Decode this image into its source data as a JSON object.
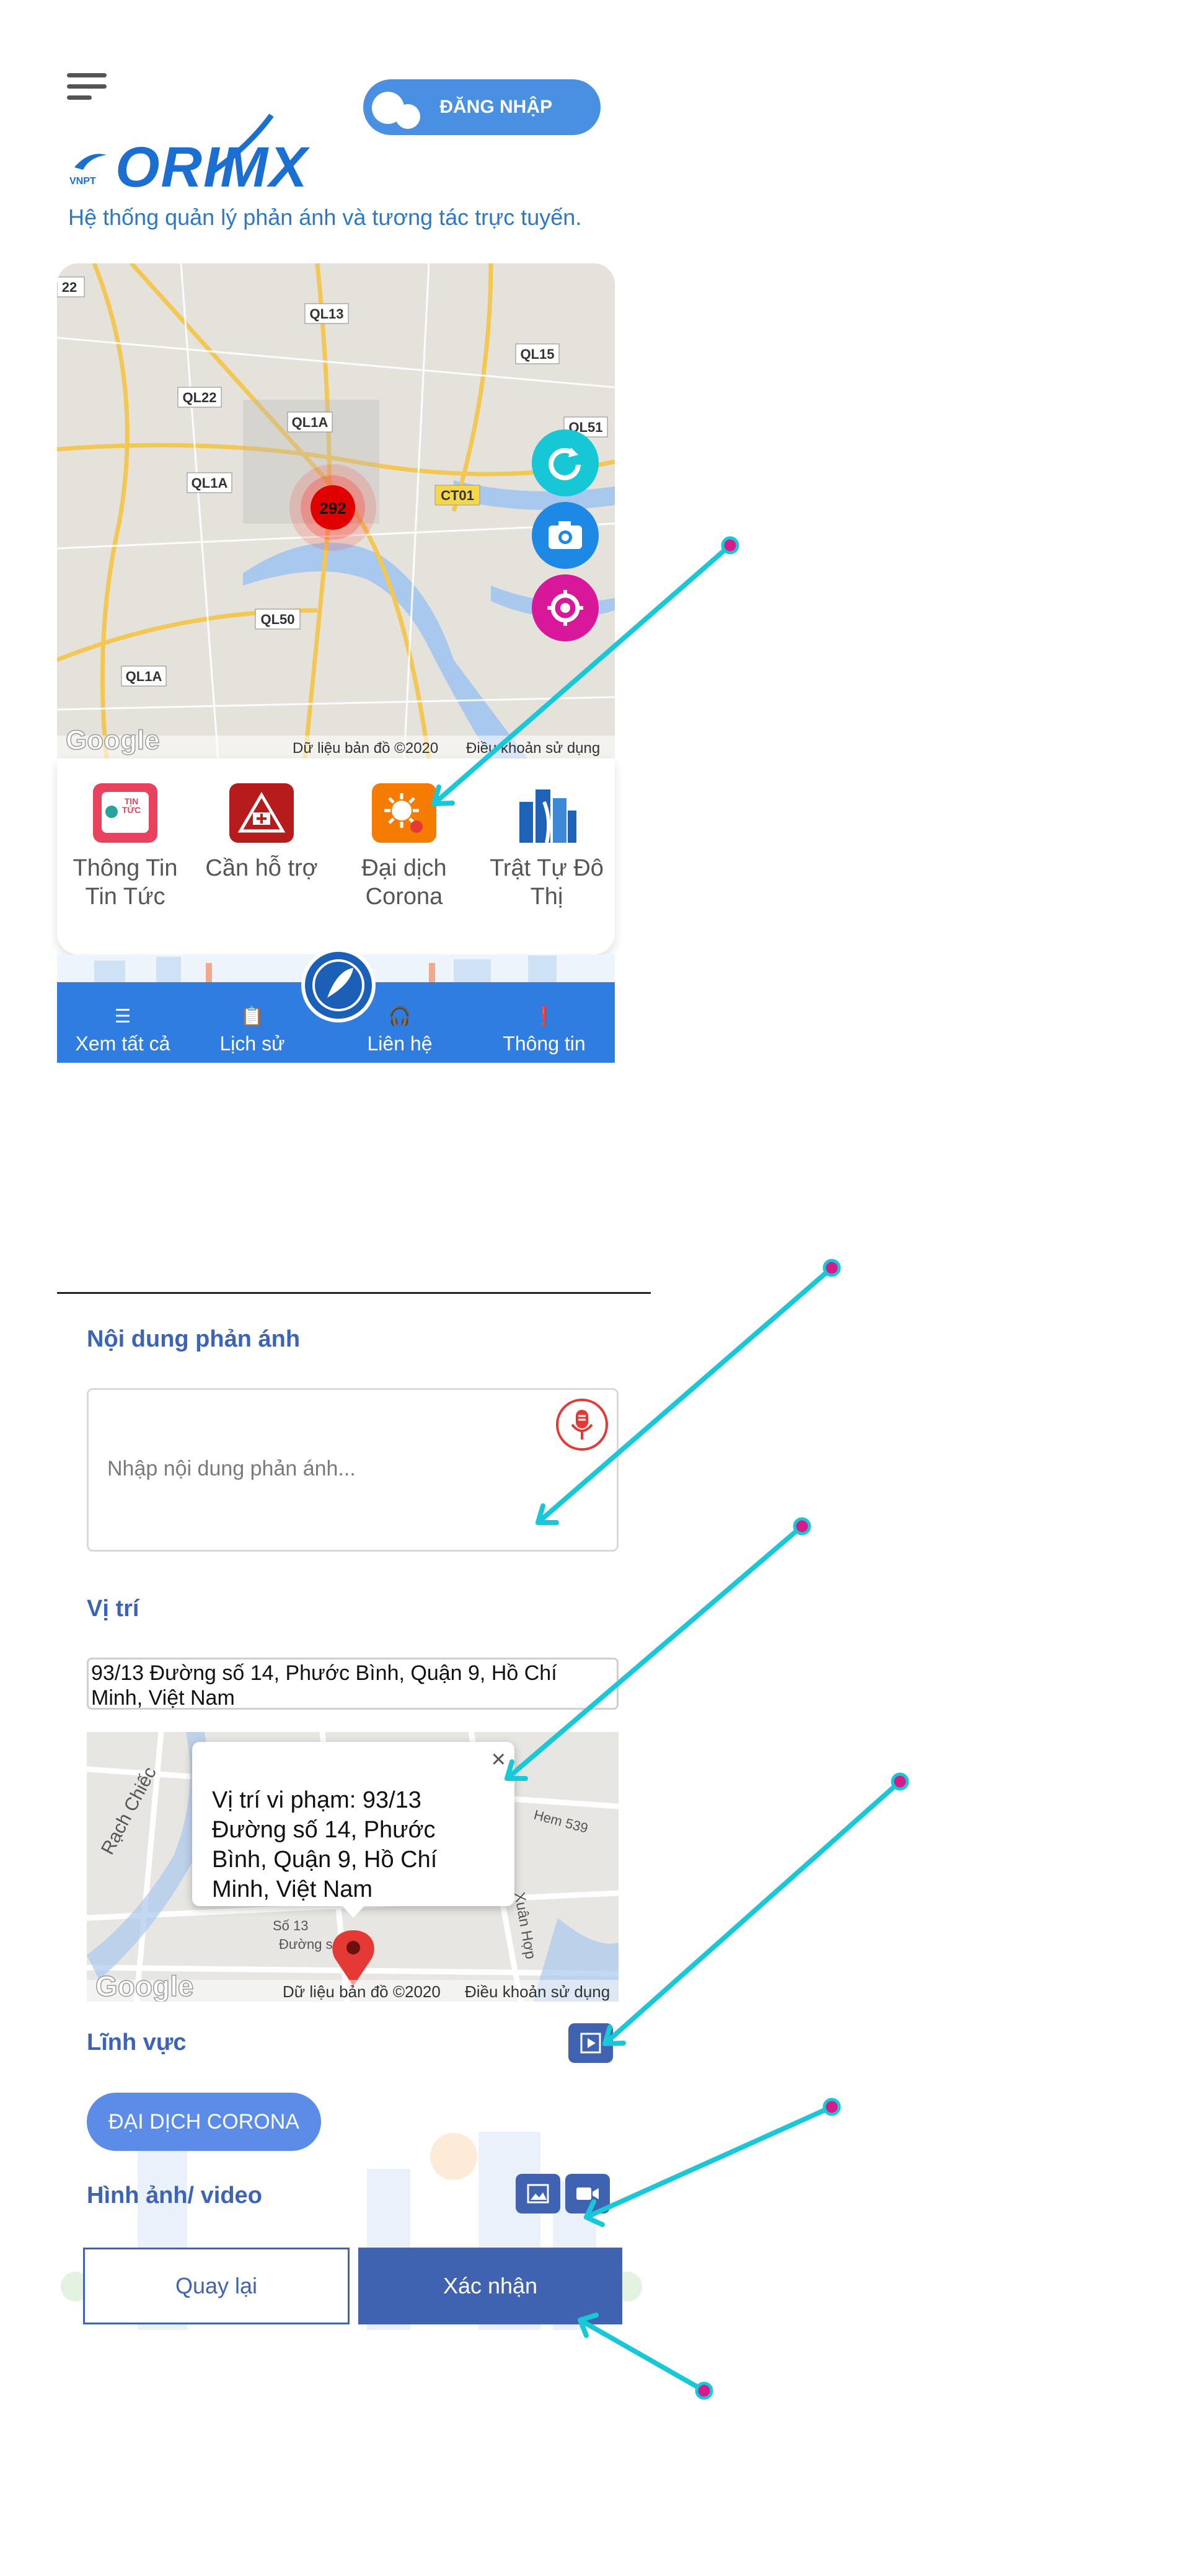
{
  "header": {
    "login_label": "ĐĂNG NHẬP",
    "logo_text": "ORIMX",
    "logo_sub": "VNPT",
    "tagline": "Hệ thống quản lý phản ánh và tương tác trực tuyến."
  },
  "map1": {
    "cluster_count": "292",
    "roads": [
      "QL13",
      "QL15",
      "QL22",
      "QL1A",
      "QL1A",
      "QL51",
      "CT01",
      "QL50",
      "QL1A",
      "22"
    ],
    "attribution": "Dữ liệu bản đồ ©2020",
    "terms": "Điều khoản sử dụng",
    "google": "Google"
  },
  "categories": [
    {
      "label": "Thông Tin Tin Tức",
      "badge": "TIN TỨC",
      "color": "#e8425f"
    },
    {
      "label": "Cần hỗ trợ",
      "color": "#b71c1c"
    },
    {
      "label": "Đại dịch Corona",
      "color": "#f57c00"
    },
    {
      "label": "Trật Tự Đô Thị",
      "color": "#1e63b8"
    }
  ],
  "bottom_nav": [
    {
      "label": "Xem tất cả",
      "icon": "list-icon"
    },
    {
      "label": "Lịch sử",
      "icon": "clipboard-icon"
    },
    {
      "label": "Liên hệ",
      "icon": "headset-icon"
    },
    {
      "label": "Thông tin",
      "icon": "info-icon"
    }
  ],
  "form": {
    "content_title": "Nội dung phản ánh",
    "content_placeholder": "Nhập nội dung phản ánh...",
    "location_title": "Vị trí",
    "address": "93/13 Đường số 14, Phước Bình, Quận 9, Hồ Chí Minh, Việt Nam",
    "popup_text": "Vị trí vi phạm: 93/13 Đường số 14, Phước Bình, Quận 9, Hồ Chí Minh, Việt Nam",
    "popup_close": "×",
    "map_labels": [
      "Rạch Chiếc",
      "Hem 539",
      "Số 13",
      "Đường số",
      "Xuân Hợp"
    ],
    "map_attribution": "Dữ liệu bản đồ ©2020",
    "map_terms": "Điều khoản sử dụng",
    "google": "Google",
    "field_title": "Lĩnh vực",
    "field_value": "ĐẠI DỊCH CORONA",
    "media_title": "Hình ảnh/ video",
    "back_label": "Quay lại",
    "confirm_label": "Xác nhận"
  },
  "colors": {
    "primary": "#2f7de0",
    "form_primary": "#3f63b0",
    "annotation_arrow": "#18c8d8",
    "annotation_dot": "#d81b8a"
  }
}
